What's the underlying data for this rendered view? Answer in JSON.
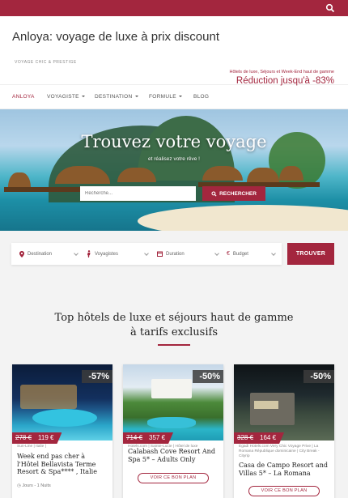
{
  "header": {
    "brand": "Anloya: voyage de luxe à prix discount",
    "tagline": "VOYAGE CHIC & PRESTIGE",
    "promo_small": "Hôtels de luxe, Séjours et Week-End haut de gamme",
    "promo_big": "Réduction jusqu'à -83%"
  },
  "nav": {
    "items": [
      {
        "label": "ANLOYA"
      },
      {
        "label": "VOYAGISTE"
      },
      {
        "label": "DESTINATION"
      },
      {
        "label": "FORMULE"
      },
      {
        "label": "BLOG"
      }
    ]
  },
  "hero": {
    "title": "Trouvez votre voyage",
    "subtitle": "et réalisez votre rêve !",
    "search_placeholder": "Recherche...",
    "search_button": "RECHERCHER"
  },
  "filters": {
    "destination": "Destination",
    "voyagistes": "Voyagistes",
    "duration": "Duration",
    "budget": "Budget",
    "submit": "TROUVER"
  },
  "section": {
    "title_line1": "Top hôtels de luxe et séjours haut de gamme",
    "title_line2": "à tarifs exclusifs"
  },
  "cards": [
    {
      "discount": "-57%",
      "old_price": "278 €",
      "new_price": "119 €",
      "source": "Sun-Line | Italie |",
      "title": "Week end pas cher à l'Hôtel Bellavista Terme Resort & Spa**** , Italie",
      "duration": "Jours - 1 Nuits",
      "cta": ""
    },
    {
      "discount": "-50%",
      "old_price": "714 €",
      "new_price": "357 €",
      "source": "Hotels.com | Sainte-Lucie | Hôtel de luxe",
      "title": "Calabash Cove Resort And Spa 5* – Adults Only",
      "duration": "",
      "cta": "VOIR CE BON PLAN"
    },
    {
      "discount": "-50%",
      "old_price": "328 €",
      "new_price": "164 €",
      "source": "Egadi Hotels.com Very Chic Voyage Prive | La Romana République dominicaine | City Break - Cityrip",
      "title": "Casa de Campo Resort and Villas 5* – La Romana",
      "duration": "",
      "cta": "VOIR CE BON PLAN"
    }
  ],
  "colors": {
    "accent": "#a3263e",
    "background_section": "#f3f3f3"
  }
}
